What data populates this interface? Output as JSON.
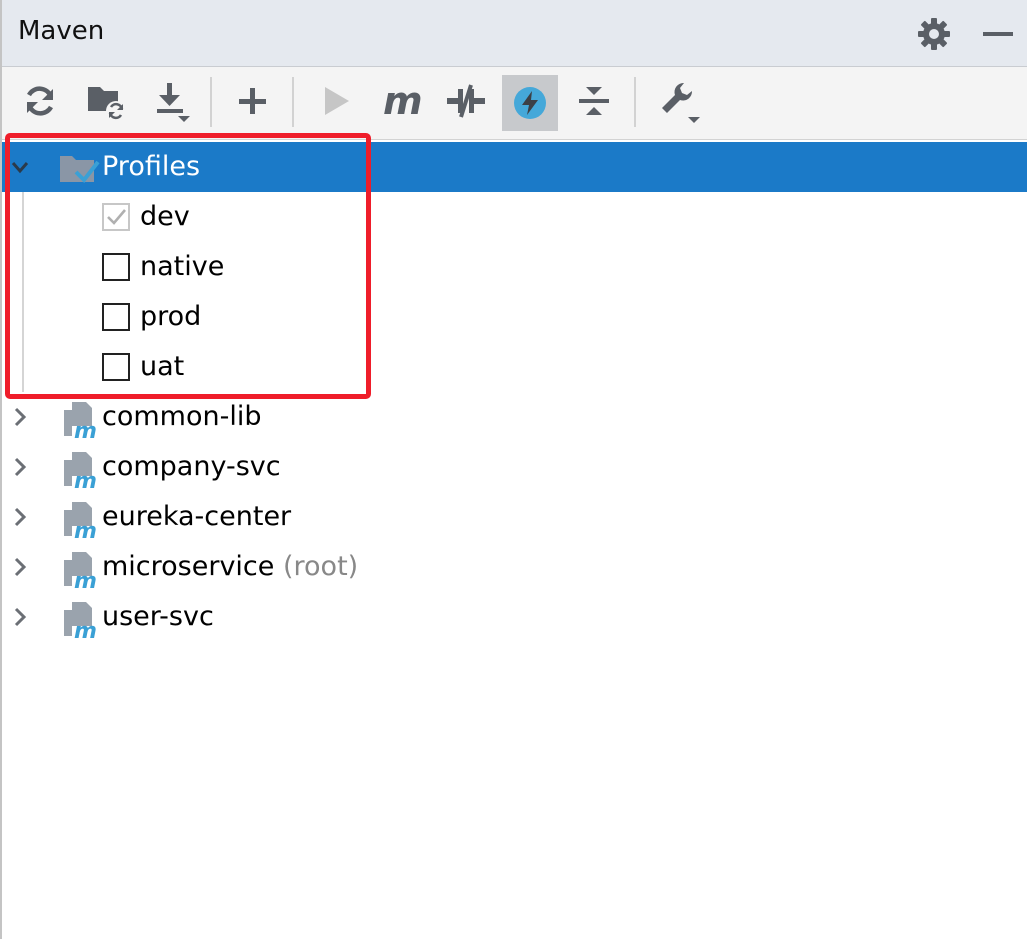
{
  "window": {
    "title": "Maven"
  },
  "header_icons": [
    "gear-icon",
    "minimize-icon"
  ],
  "toolbar": {
    "buttons": [
      {
        "name": "reload-all-projects-button",
        "icon": "refresh-icon"
      },
      {
        "name": "generate-sources-button",
        "icon": "folder-refresh-icon"
      },
      {
        "name": "download-sources-button",
        "icon": "download-icon"
      },
      {
        "name": "add-maven-project-button",
        "icon": "plus-icon"
      },
      {
        "name": "run-maven-build-button",
        "icon": "run-icon"
      },
      {
        "name": "execute-maven-goal-button",
        "icon": "maven-m-icon"
      },
      {
        "name": "toggle-offline-mode-button",
        "icon": "offline-icon"
      },
      {
        "name": "toggle-skip-tests-button",
        "icon": "lightning-icon",
        "active": true
      },
      {
        "name": "collapse-all-button",
        "icon": "collapse-icon"
      },
      {
        "name": "maven-settings-button",
        "icon": "wrench-icon"
      }
    ]
  },
  "tree": {
    "profiles": {
      "label": "Profiles",
      "expanded": true,
      "selected": true,
      "items": [
        {
          "label": "dev",
          "checked": true
        },
        {
          "label": "native",
          "checked": false
        },
        {
          "label": "prod",
          "checked": false
        },
        {
          "label": "uat",
          "checked": false
        }
      ]
    },
    "modules": [
      {
        "label": "common-lib",
        "suffix": ""
      },
      {
        "label": "company-svc",
        "suffix": ""
      },
      {
        "label": "eureka-center",
        "suffix": ""
      },
      {
        "label": "microservice",
        "suffix": "(root)"
      },
      {
        "label": "user-svc",
        "suffix": ""
      }
    ]
  },
  "colors": {
    "selection": "#1b7ac8",
    "highlight_annotation": "#ef1d2a",
    "maven_blue": "#3aa0d5",
    "icon_gray": "#5a5f66"
  }
}
